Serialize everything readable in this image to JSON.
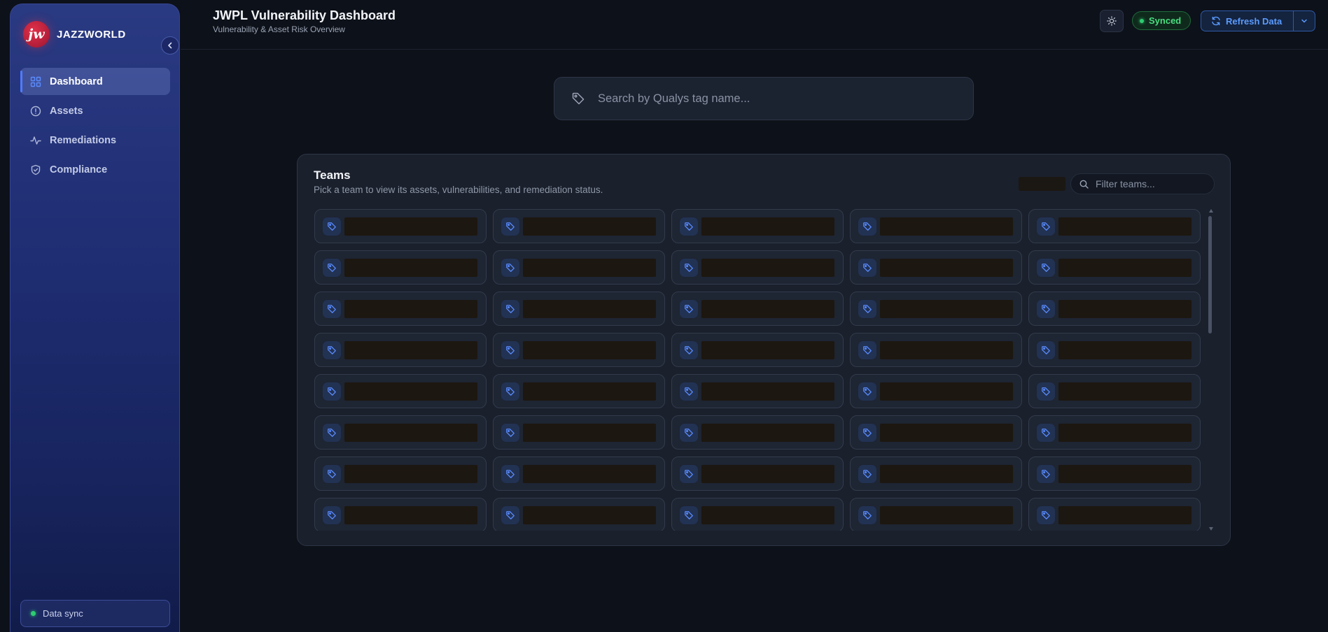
{
  "brand": {
    "name": "JAZZWORLD",
    "logo_text": "jw"
  },
  "sidebar": {
    "items": [
      {
        "label": "Dashboard",
        "icon": "grid-icon",
        "active": true
      },
      {
        "label": "Assets",
        "icon": "alert-circle-icon",
        "active": false
      },
      {
        "label": "Remediations",
        "icon": "activity-icon",
        "active": false
      },
      {
        "label": "Compliance",
        "icon": "shield-check-icon",
        "active": false
      }
    ],
    "sync_label": "Data sync"
  },
  "header": {
    "title": "JWPL Vulnerability Dashboard",
    "subtitle": "Vulnerability & Asset Risk Overview",
    "status": "Synced",
    "refresh_label": "Refresh Data"
  },
  "search": {
    "placeholder": "Search by Qualys tag name..."
  },
  "teams": {
    "title": "Teams",
    "subtitle": "Pick a team to view its assets, vulnerabilities, and remediation status.",
    "filter_placeholder": "Filter teams...",
    "visible_cards": 40
  },
  "colors": {
    "accent": "#4f7cff",
    "status_green": "#4ade80",
    "brand_red": "#e0304a"
  }
}
